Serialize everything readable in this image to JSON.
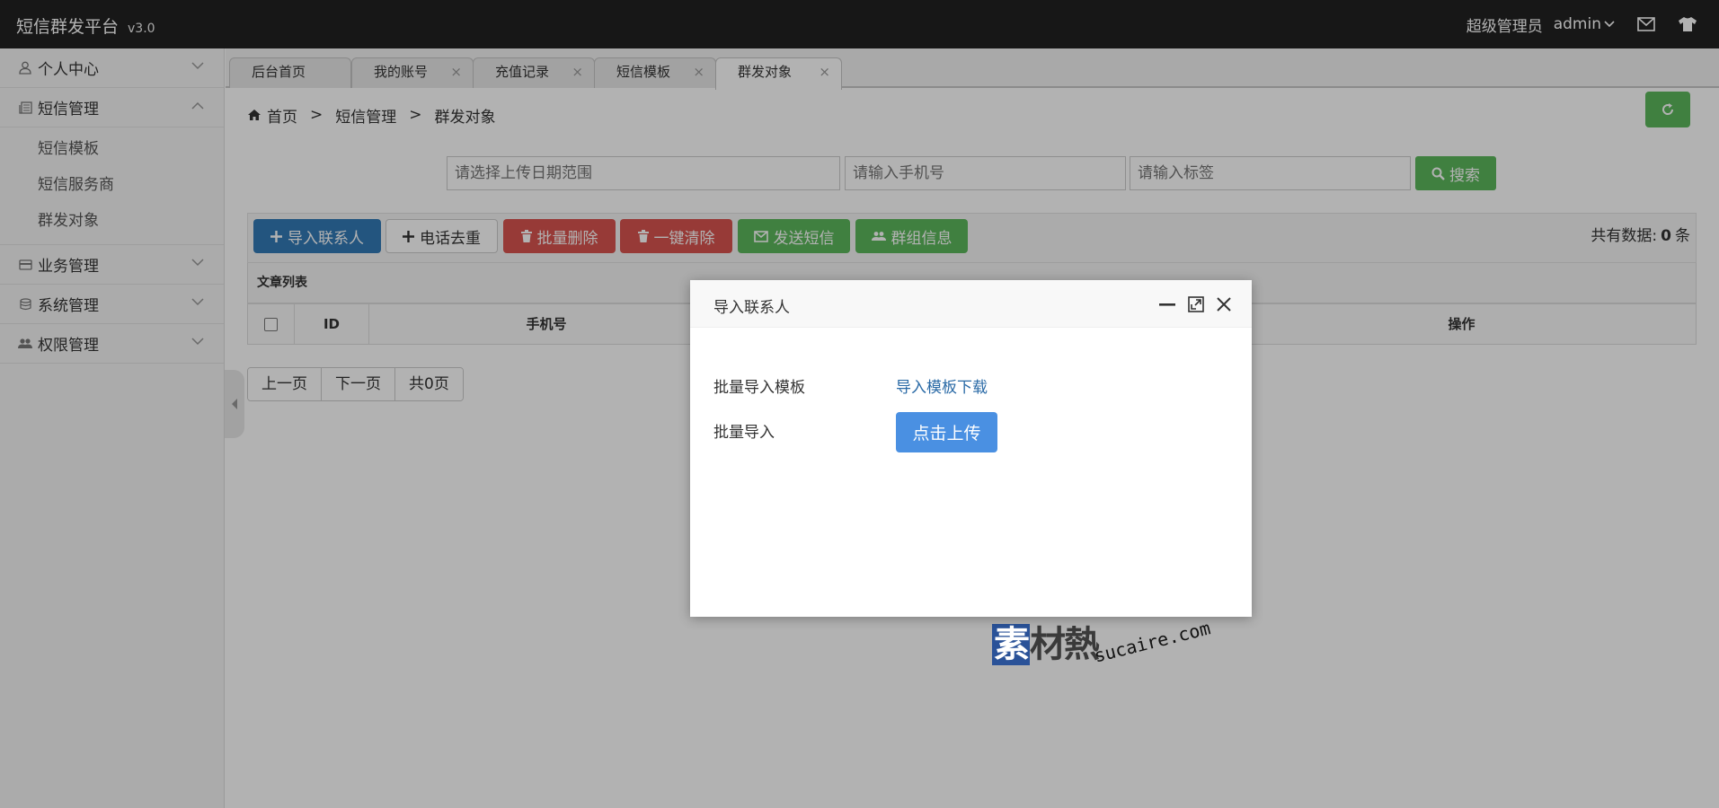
{
  "app": {
    "title": "短信群发平台",
    "version": "v3.0"
  },
  "topbar": {
    "role": "超级管理员",
    "username": "admin",
    "mail_icon": "mail-icon",
    "skin_icon": "tshirt-icon"
  },
  "sidebar": {
    "items": [
      {
        "label": "个人中心",
        "icon": "user-icon"
      },
      {
        "label": "短信管理",
        "icon": "newspaper-icon"
      },
      {
        "label": "业务管理",
        "icon": "card-icon"
      },
      {
        "label": "系统管理",
        "icon": "database-icon"
      },
      {
        "label": "权限管理",
        "icon": "users-icon"
      }
    ],
    "sub": [
      "短信模板",
      "短信服务商",
      "群发对象"
    ]
  },
  "tabs": [
    {
      "label": "后台首页"
    },
    {
      "label": "我的账号"
    },
    {
      "label": "充值记录"
    },
    {
      "label": "短信模板"
    },
    {
      "label": "群发对象"
    }
  ],
  "breadcrumb": {
    "home": "首页",
    "sep": ">",
    "level1": "短信管理",
    "level2": "群发对象"
  },
  "search": {
    "date_placeholder": "请选择上传日期范围",
    "phone_placeholder": "请输入手机号",
    "tag_placeholder": "请输入标签",
    "button": "搜索"
  },
  "toolbar": {
    "import": "导入联系人",
    "dedupe": "电话去重",
    "batch_delete": "批量删除",
    "clear_all": "一键清除",
    "send_sms": "发送短信",
    "group_info": "群组信息",
    "total_prefix": "共有数据:",
    "total_count": "0",
    "total_suffix": "条"
  },
  "table": {
    "title": "文章列表",
    "headers": {
      "id": "ID",
      "phone": "手机号",
      "action": "操作"
    }
  },
  "pager": {
    "prev": "上一页",
    "next": "下一页",
    "total": "共0页"
  },
  "modal": {
    "title": "导入联系人",
    "template_label": "批量导入模板",
    "template_link": "导入模板下载",
    "import_label": "批量导入",
    "upload_button": "点击上传"
  },
  "watermark": {
    "main_first": "素",
    "main_rest": "材熱",
    "sub": "sucaire.com"
  },
  "colors": {
    "topbar": "#222222",
    "primary": "#337ab7",
    "success": "#5cb85c",
    "danger": "#d9534f",
    "link": "#2a6aa6",
    "upload": "#4a90e2"
  }
}
